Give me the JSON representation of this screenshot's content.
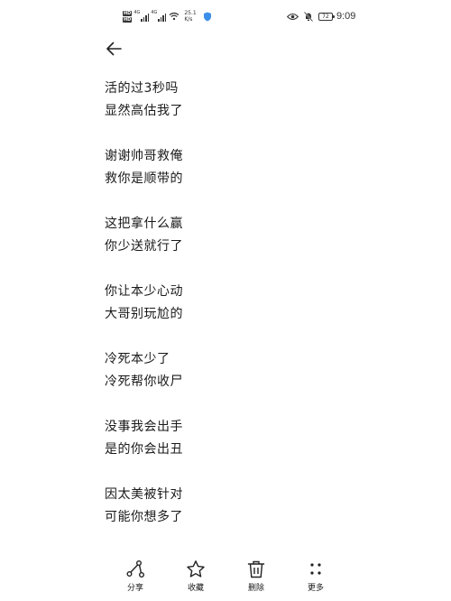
{
  "status_bar": {
    "sim1_badge": "HD",
    "sim2_badge": "HD",
    "signal1_label": "4G",
    "signal2_label": "4G",
    "net_speed_value": "25.1",
    "net_speed_unit": "K/s",
    "battery_level": "72",
    "time": "9:09"
  },
  "poem": {
    "stanzas": [
      [
        "活的过3秒吗",
        "显然高估我了"
      ],
      [
        "谢谢帅哥救俺",
        "救你是顺带的"
      ],
      [
        "这把拿什么赢",
        "你少送就行了"
      ],
      [
        "你让本少心动",
        "大哥别玩尬的"
      ],
      [
        "冷死本少了",
        "冷死帮你收尸"
      ],
      [
        "没事我会出手",
        "是的你会出丑"
      ],
      [
        "因太美被针对",
        "可能你想多了"
      ]
    ]
  },
  "toolbar": {
    "share_label": "分享",
    "favorite_label": "收藏",
    "delete_label": "删除",
    "more_label": "更多"
  },
  "icons": {
    "back": "arrow-left-icon",
    "share": "share-icon",
    "favorite": "star-icon",
    "delete": "trash-icon",
    "more": "more-dots-icon"
  }
}
